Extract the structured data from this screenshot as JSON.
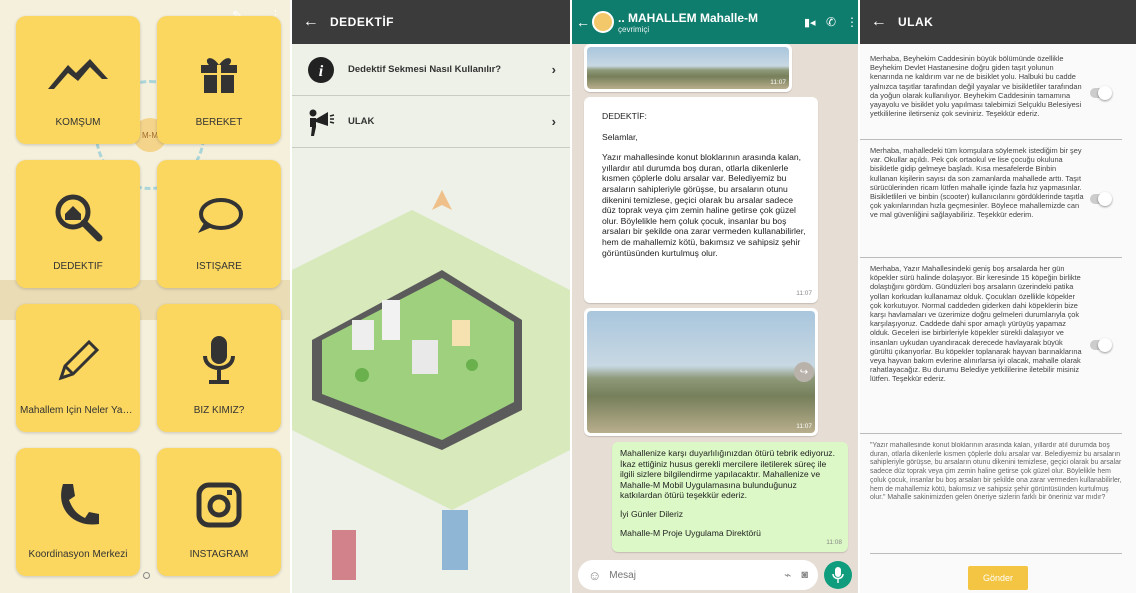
{
  "grid": {
    "tiles": [
      {
        "label": "KOMŞUM",
        "icon": "house-icon"
      },
      {
        "label": "BEREKET",
        "icon": "gift-icon"
      },
      {
        "label": "DEDEKTİF",
        "icon": "magnifier-icon"
      },
      {
        "label": "İSTİŞARE",
        "icon": "chat-icon"
      },
      {
        "label": "Mahallem İçin Neler Yapabi...",
        "icon": "pencil-icon"
      },
      {
        "label": "BİZ KİMİZ?",
        "icon": "microphone-icon"
      },
      {
        "label": "Koordinasyon Merkezi",
        "icon": "phone-icon"
      },
      {
        "label": "İNSTAGRAM",
        "icon": "instagram-icon"
      }
    ],
    "bg_badge": "M-M"
  },
  "dedektif": {
    "title": "DEDEKTİF",
    "items": [
      {
        "label": "Dedektif Sekmesi Nasıl Kullanılır?",
        "icon": "info-icon"
      },
      {
        "label": "ULAK",
        "icon": "megaphone-icon"
      }
    ]
  },
  "chat": {
    "title": ".. MAHALLEM Mahalle-M",
    "status": "çevrimiçi",
    "msg1_time": "11:07",
    "msg2": {
      "header": "DEDEKTİF:",
      "greeting": "Selamlar,",
      "body": "Yazır mahallesinde konut bloklarının arasında kalan, yıllardır atıl durumda boş duran, otlarla dikenlerle kısmen çöplerle dolu arsalar var. Belediyemiz bu arsaların sahipleriyle görüşse, bu arsaların otunu dikenini temizlese, geçici olarak bu arsalar sadece düz toprak veya çim zemin haline getirse çok güzel olur. Böylelikle hem çoluk çocuk, insanlar bu boş arsaları bir şekilde ona zarar vermeden kullanabilirler, hem de mahallemiz kötü, bakımsız ve sahipsiz şehir görüntüsünden kurtulmuş olur.",
      "time": "11:07"
    },
    "msg3_time": "11:07",
    "reply": {
      "body": "Mahallenize karşı duyarlılığınızdan ötürü tebrik ediyoruz. İkaz ettiğiniz husus gerekli mercilere iletilerek süreç ile ilgili sizlere bilgilendirme yapılacaktır. Mahallenize ve Mahalle-M Mobil Uygulamasına bulunduğunuz katkılardan ötürü teşekkür ederiz.",
      "wish": "İyi Günler Dileriz",
      "sign": "Mahalle-M Proje Uygulama Direktörü",
      "time": "11:08"
    },
    "input_placeholder": "Mesaj"
  },
  "ulak": {
    "title": "ULAK",
    "items": [
      {
        "text": "Merhaba, Beyhekim Caddesinin büyük bölümünde özellikle Beyhekim Devlet Hastanesine doğru giden taşıt yolunun kenarında ne kaldırım var ne de bisiklet yolu. Halbuki bu cadde yalnızca taşıtlar tarafından değil yayalar ve bisikletliler tarafından da yoğun olarak kullanılıyor. Beyhekim Caddesinin tamamına yayayolu ve bisiklet yolu yapılması talebimizi Selçuklu Belesiyesi yetkililerine iletirseniz çok seviniriz. Teşekkür ederiz."
      },
      {
        "text": "Merhaba, mahalledeki tüm komşulara söylemek istediğim bir şey var. Okullar açıldı. Pek çok ortaokul ve lise çocuğu okuluna bisikletle gidip gelmeye başladı. Kısa mesafelerde Binbin kullanan kişilerin sayısı da son zamanlarda mahallede arttı. Taşıt sürücülerinden ricam lütfen mahalle içinde fazla hız yapmasınlar. Bisikletlileri ve binbin (scooter) kullanıcılarını gördüklerinde taşıtla çok yakınlarından hızla geçmesinler. Böylece mahallemizde can ve mal güvenliğini sağlayabiliriz. Teşekkür ederim."
      },
      {
        "text": "Merhaba, Yazır Mahallesindeki geniş boş arsalarda her gün köpekler sürü halinde dolaşıyor. Bir keresinde 15 köpeğin birlikte dolaştığını gördüm. Gündüzleri boş arsaların üzerindeki patika yolları korkudan kullanamaz olduk. Çocukları özellikle köpekler çok korkutuyor. Normal caddeden giderken dahi köpeklerin bize karşı havlamaları ve üzerimize doğru gelmeleri durumlarıyla çok karşılaşıyoruz. Caddede dahi spor amaçlı yürüyüş yapamaz olduk. Geceleri ise birbirleriyle köpekler sürekli dalaşıyor ve insanları uykudan uyandıracak derecede havlayarak büyük gürültü çıkarıyorlar. Bu köpekler toplanarak hayvan barınaklarına veya hayvan bakım evlerine alınırlarsa iyi olacak, mahalle olarak rahatlayacağız. Bu durumu Belediye yetkililerine iletebilir misiniz lütfen. Teşekkür ederiz."
      }
    ],
    "draft": "\"Yazır mahallesinde konut bloklarının arasında kalan, yıllardır atıl durumda boş duran, otlarla dikenlerle kısmen çöplerle dolu arsalar var. Belediyemiz bu arsaların sahipleriyle görüşse, bu arsaların otunu dikenini temizlese, geçici olarak bu arsalar sadece düz toprak veya çim zemin haline getirse çok güzel olur. Böylelikle hem çoluk çocuk, insanlar bu boş arsaları bir şekilde ona zarar vermeden kullanabilirler, hem de mahallemiz kötü, bakımsız ve sahipsiz şehir görüntüsünden kurtulmuş olur.\" Mahalle sakinimizden gelen öneriye sizlerin farklı bir öneriniz var mıdır?",
    "send_label": "Gönder"
  },
  "colors": {
    "tile": "#fbd75f",
    "whatsapp_green": "#0f7d6e",
    "toolbar": "#3b3b3b",
    "send": "#f4c542"
  }
}
